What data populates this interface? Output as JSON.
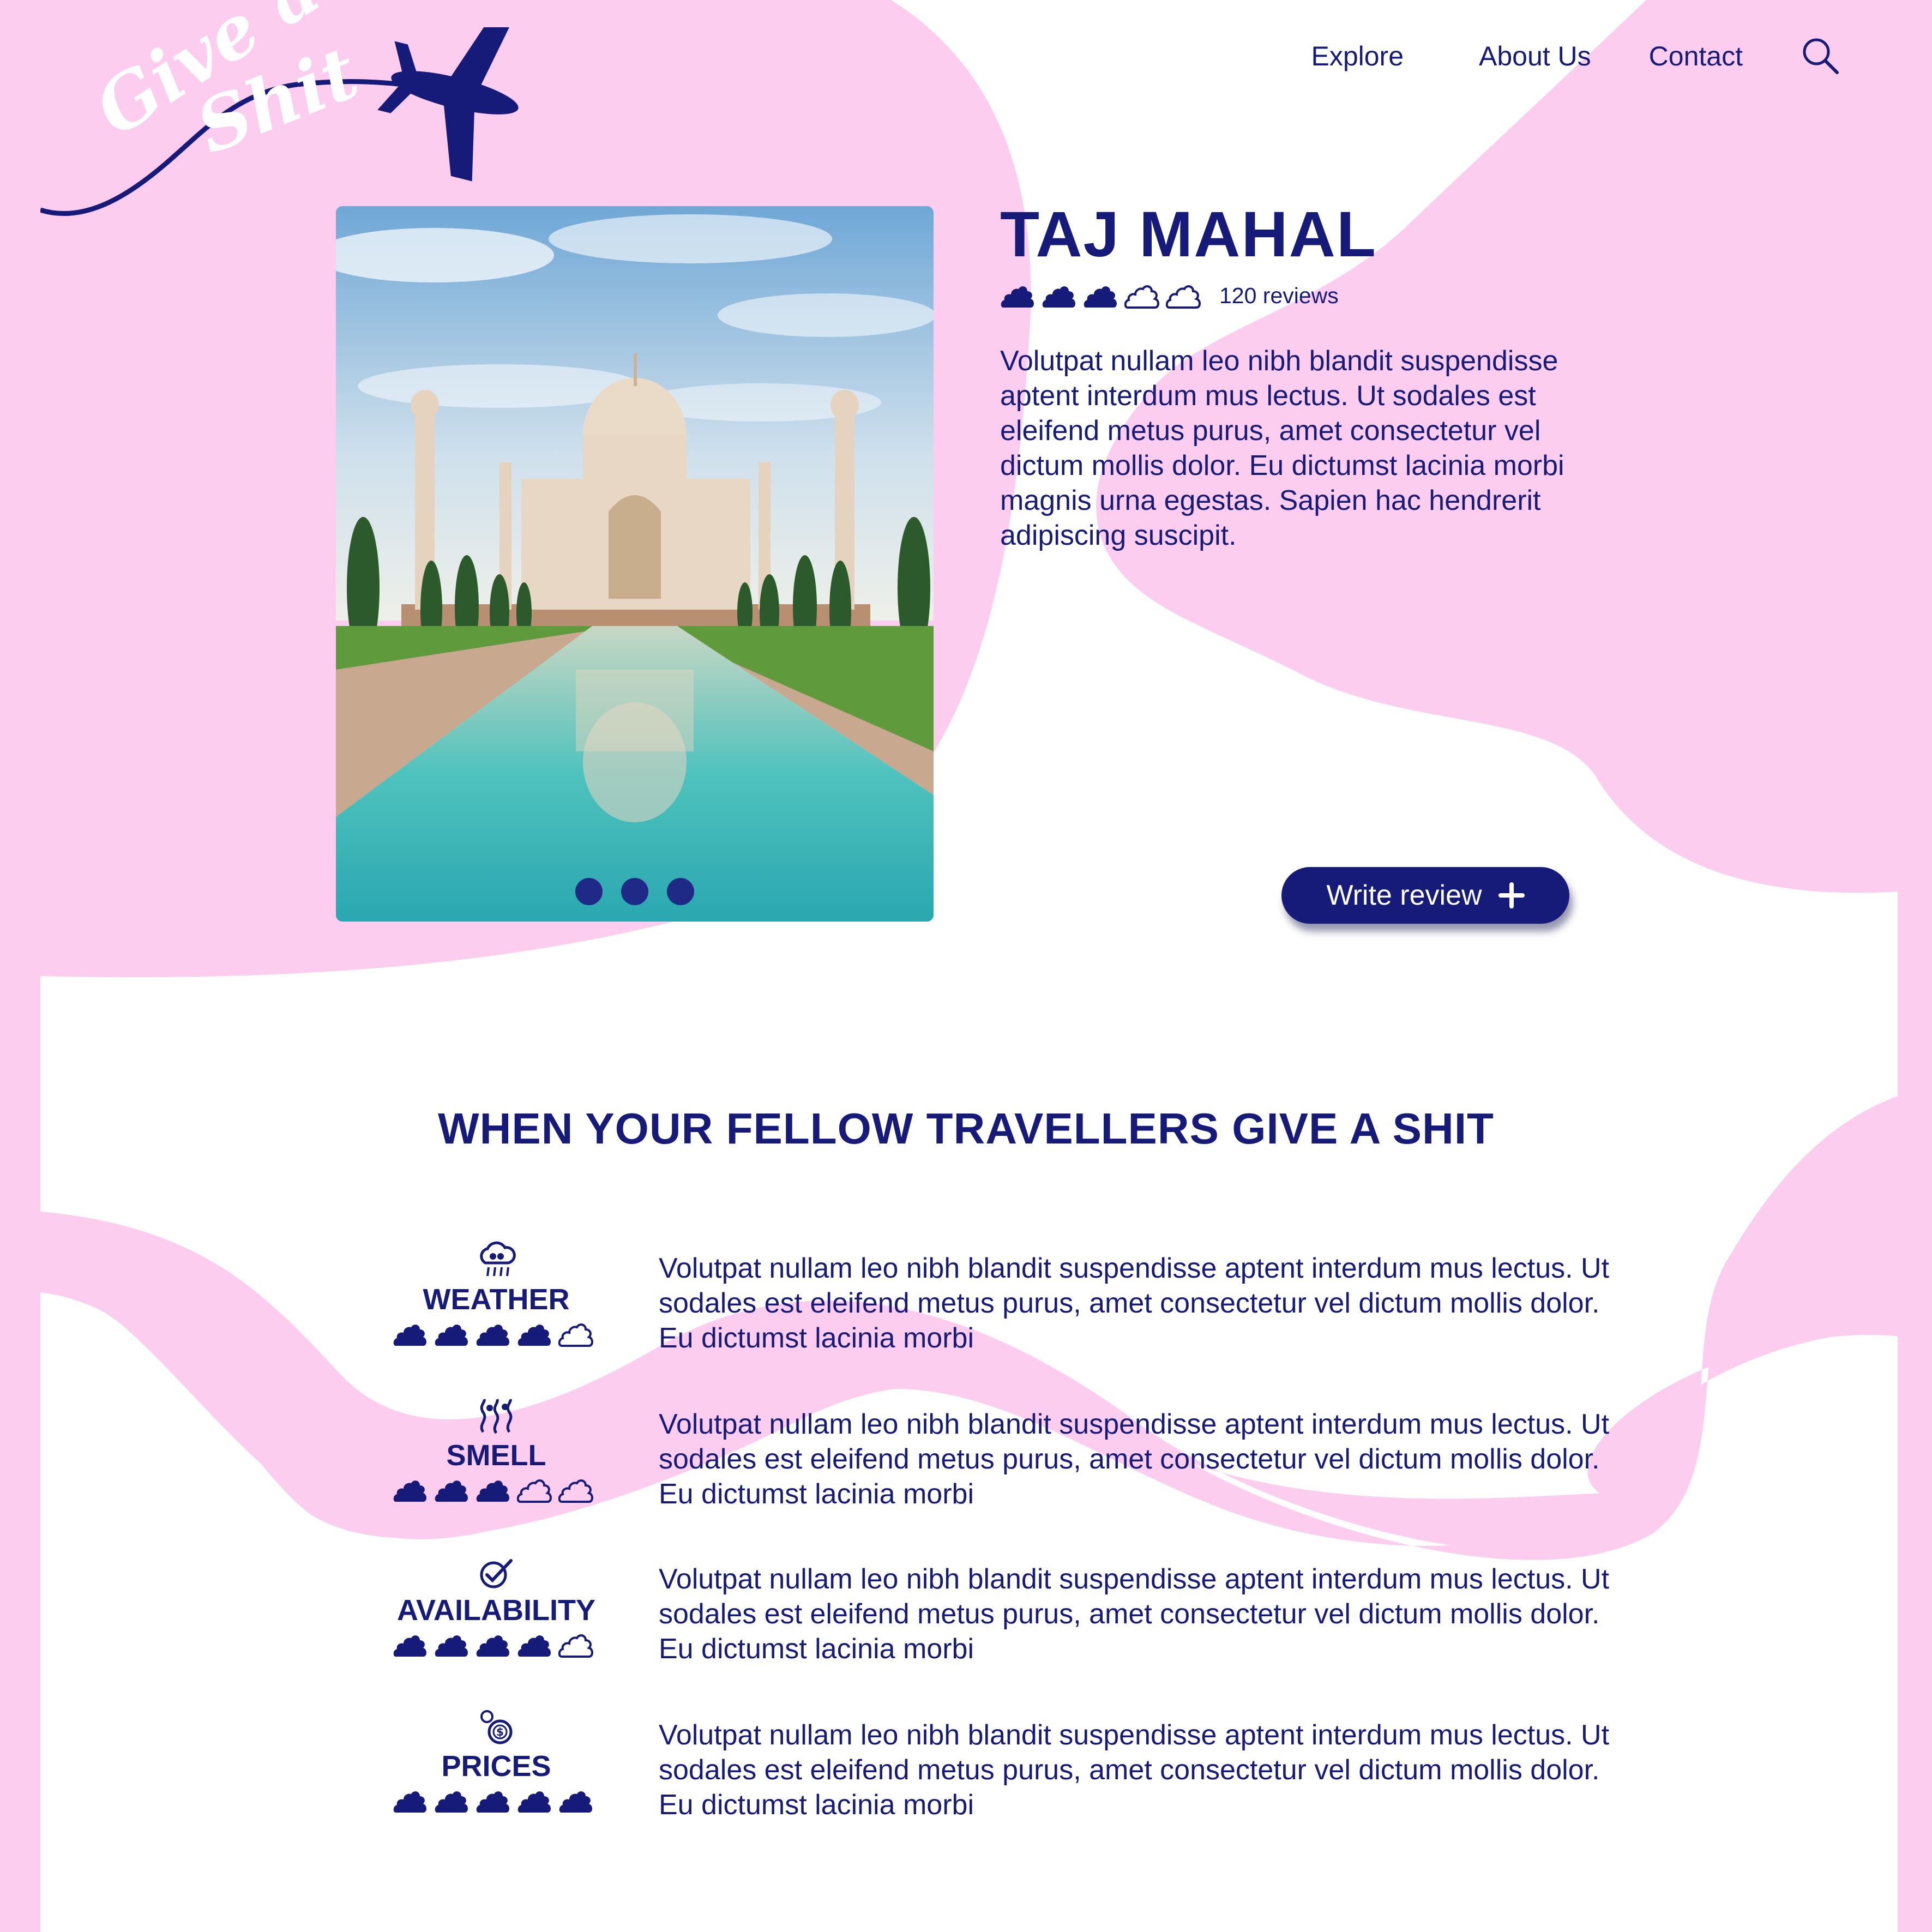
{
  "brand": {
    "logo_line1": "Give a",
    "logo_line2": "Shit"
  },
  "nav": {
    "items": [
      "Explore",
      "About Us",
      "Contact"
    ],
    "search_icon": "search-icon"
  },
  "hero": {
    "title": "TAJ MAHAL",
    "rating": 3,
    "rating_max": 5,
    "reviews_label": "120 reviews",
    "description": "Volutpat nullam leo nibh blandit suspendisse aptent interdum mus lectus. Ut sodales est eleifend metus purus, amet consectetur vel dictum mollis dolor. Eu dictumst lacinia morbi magnis urna egestas. Sapien hac hendrerit adipiscing suscipit.",
    "carousel_slides": 3,
    "write_review_label": "Write review"
  },
  "section": {
    "title": "WHEN YOUR FELLOW TRAVELLERS GIVE A SHIT",
    "criteria": [
      {
        "label": "WEATHER",
        "icon": "rain-cloud-icon",
        "rating": 4,
        "text": "Volutpat nullam leo nibh blandit suspendisse aptent interdum mus lectus. Ut sodales est eleifend metus purus, amet consectetur vel dictum mollis dolor. Eu dictumst lacinia morbi"
      },
      {
        "label": "SMELL",
        "icon": "smell-icon",
        "rating": 3,
        "text": "Volutpat nullam leo nibh blandit suspendisse aptent interdum mus lectus. Ut sodales est eleifend metus purus, amet consectetur vel dictum mollis dolor. Eu dictumst lacinia morbi"
      },
      {
        "label": "AVAILABILITY",
        "icon": "check-circle-icon",
        "rating": 4,
        "text": "Volutpat nullam leo nibh blandit suspendisse aptent interdum mus lectus. Ut sodales est eleifend metus purus, amet consectetur vel dictum mollis dolor. Eu dictumst lacinia morbi"
      },
      {
        "label": "PRICES",
        "icon": "coins-icon",
        "rating": 5,
        "text": "Volutpat nullam leo nibh blandit suspendisse aptent interdum mus lectus. Ut sodales est eleifend metus purus, amet consectetur vel dictum mollis dolor. Eu dictumst lacinia morbi"
      }
    ]
  },
  "colors": {
    "primary": "#161b7a",
    "pink": "#fccdef",
    "white": "#ffffff"
  }
}
